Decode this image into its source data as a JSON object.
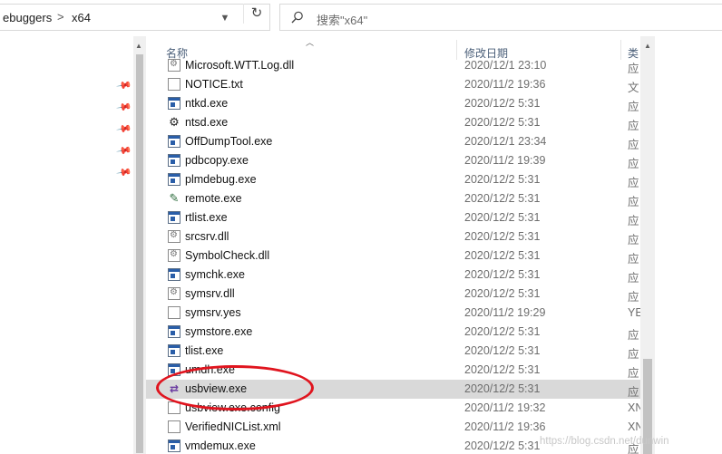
{
  "address": {
    "crumbs": [
      "ebuggers",
      "x64"
    ],
    "separator": ">"
  },
  "search": {
    "placeholder": "搜索\"x64\""
  },
  "columns": {
    "name": "名称",
    "date": "修改日期",
    "type": "类"
  },
  "files": [
    {
      "name": "Microsoft.WTT.Log.dll",
      "date": "2020/12/1 23:10",
      "type": "应",
      "icon": "dll-icon"
    },
    {
      "name": "NOTICE.txt",
      "date": "2020/11/2 19:36",
      "type": "文",
      "icon": "text-file-icon"
    },
    {
      "name": "ntkd.exe",
      "date": "2020/12/2 5:31",
      "type": "应",
      "icon": "exe-icon"
    },
    {
      "name": "ntsd.exe",
      "date": "2020/12/2 5:31",
      "type": "应",
      "icon": "ntsd-icon"
    },
    {
      "name": "OffDumpTool.exe",
      "date": "2020/12/1 23:34",
      "type": "应",
      "icon": "exe-icon"
    },
    {
      "name": "pdbcopy.exe",
      "date": "2020/11/2 19:39",
      "type": "应",
      "icon": "exe-icon"
    },
    {
      "name": "plmdebug.exe",
      "date": "2020/12/2 5:31",
      "type": "应",
      "icon": "exe-icon"
    },
    {
      "name": "remote.exe",
      "date": "2020/12/2 5:31",
      "type": "应",
      "icon": "remote-icon"
    },
    {
      "name": "rtlist.exe",
      "date": "2020/12/2 5:31",
      "type": "应",
      "icon": "exe-icon"
    },
    {
      "name": "srcsrv.dll",
      "date": "2020/12/2 5:31",
      "type": "应",
      "icon": "dll-icon"
    },
    {
      "name": "SymbolCheck.dll",
      "date": "2020/12/2 5:31",
      "type": "应",
      "icon": "dll-icon"
    },
    {
      "name": "symchk.exe",
      "date": "2020/12/2 5:31",
      "type": "应",
      "icon": "exe-icon"
    },
    {
      "name": "symsrv.dll",
      "date": "2020/12/2 5:31",
      "type": "应",
      "icon": "dll-icon"
    },
    {
      "name": "symsrv.yes",
      "date": "2020/11/2 19:29",
      "type": "YE",
      "icon": "blank-file-icon"
    },
    {
      "name": "symstore.exe",
      "date": "2020/12/2 5:31",
      "type": "应",
      "icon": "exe-icon"
    },
    {
      "name": "tlist.exe",
      "date": "2020/12/2 5:31",
      "type": "应",
      "icon": "exe-icon"
    },
    {
      "name": "umdh.exe",
      "date": "2020/12/2 5:31",
      "type": "应",
      "icon": "exe-icon"
    },
    {
      "name": "usbview.exe",
      "date": "2020/12/2 5:31",
      "type": "应",
      "icon": "usb-icon",
      "selected": true
    },
    {
      "name": "usbview.exe.config",
      "date": "2020/11/2 19:32",
      "type": "XN",
      "icon": "config-file-icon"
    },
    {
      "name": "VerifiedNICList.xml",
      "date": "2020/11/2 19:36",
      "type": "XN",
      "icon": "xml-file-icon"
    },
    {
      "name": "vmdemux.exe",
      "date": "2020/12/2 5:31",
      "type": "应",
      "icon": "exe-icon"
    }
  ],
  "watermark": "https://blog.csdn.net/dunwin",
  "colors": {
    "annotation": "#e0141e",
    "selected_row": "#d9d9d9"
  }
}
